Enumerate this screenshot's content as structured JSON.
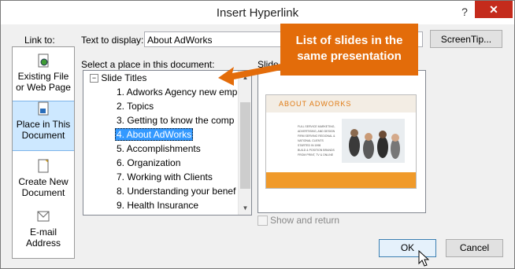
{
  "window": {
    "title": "Insert Hyperlink",
    "help": "?",
    "close": "✕"
  },
  "link_to": {
    "label": "Link to:",
    "items": [
      {
        "line1": "Existing File",
        "line2": "or Web Page"
      },
      {
        "line1": "Place in This",
        "line2": "Document"
      },
      {
        "line1": "Create New",
        "line2": "Document"
      },
      {
        "line1": "E-mail",
        "line2": "Address"
      }
    ]
  },
  "text_to_display": {
    "label": "Text to display:",
    "value": "About AdWorks"
  },
  "screentip_label": "ScreenTip...",
  "place": {
    "label": "Select a place in this document:",
    "root": "Slide Titles",
    "items": [
      "1. Adworks Agency  new emp",
      "2. Topics",
      "3. Getting to know the comp",
      "4. About AdWorks",
      "5. Accomplishments",
      "6. Organization",
      "7. Working with Clients",
      "8. Understanding your benef",
      "9. Health Insurance"
    ],
    "selected_index": 3
  },
  "preview": {
    "label": "Slide p",
    "slide_title": "ABOUT ADWORKS",
    "bullets": [
      "FULL SERVICE MARKETING,",
      "ADVERTISING, AND DESIGN",
      "FIRM SERVING REGIONAL &",
      "NATIONAL CLIENTS",
      "STARTED IN 1998",
      "BUILD & POSITION BRANDS",
      "FROM PRINT, TV & ONLINE"
    ]
  },
  "show_and_return": {
    "label": "Show and return",
    "checked": false
  },
  "buttons": {
    "ok": "OK",
    "cancel": "Cancel"
  },
  "callout": {
    "line1": "List of slides in the",
    "line2": "same presentation"
  },
  "colors": {
    "callout": "#e36c0a",
    "selection": "#3399ff",
    "slide_accent": "#f09a2a"
  }
}
